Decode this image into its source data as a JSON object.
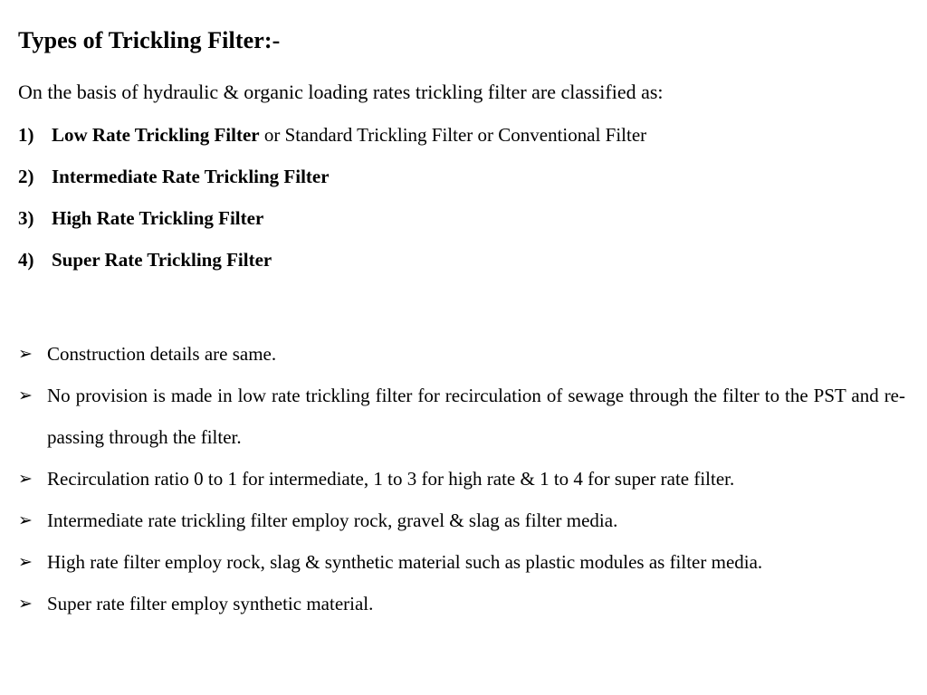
{
  "slide": {
    "title": "Types of Trickling Filter:-",
    "intro": "On the basis of hydraulic & organic loading rates trickling filter are classified as:",
    "numbered_items": [
      {
        "marker": "1)",
        "bold_text": "Low Rate Trickling Filter",
        "regular_text": " or Standard Trickling Filter or Conventional Filter"
      },
      {
        "marker": "2)",
        "bold_text": "Intermediate Rate Trickling Filter",
        "regular_text": ""
      },
      {
        "marker": "3)",
        "bold_text": "High Rate Trickling Filter",
        "regular_text": ""
      },
      {
        "marker": "4)",
        "bold_text": "Super Rate Trickling Filter",
        "regular_text": ""
      }
    ],
    "bullet_glyph": "➢",
    "bullet_glyph_name": "arrowhead-bullet-icon",
    "bullets": [
      {
        "text": "Construction details are same.",
        "justified": false
      },
      {
        "text": "No provision is made in low rate trickling filter for recirculation of sewage through the filter to the PST and re-passing through the filter.",
        "justified": true
      },
      {
        "text": "Recirculation ratio 0 to 1 for intermediate, 1 to 3 for high rate & 1 to 4 for super rate filter.",
        "justified": false
      },
      {
        "text": "Intermediate rate trickling filter employ rock, gravel & slag as filter media.",
        "justified": false
      },
      {
        "text": "High rate filter employ rock, slag & synthetic material such as plastic modules as filter media.",
        "justified": true
      },
      {
        "text": "Super rate filter employ synthetic material.",
        "justified": false
      }
    ]
  },
  "colors": {
    "background": "#ffffff",
    "text": "#000000"
  }
}
